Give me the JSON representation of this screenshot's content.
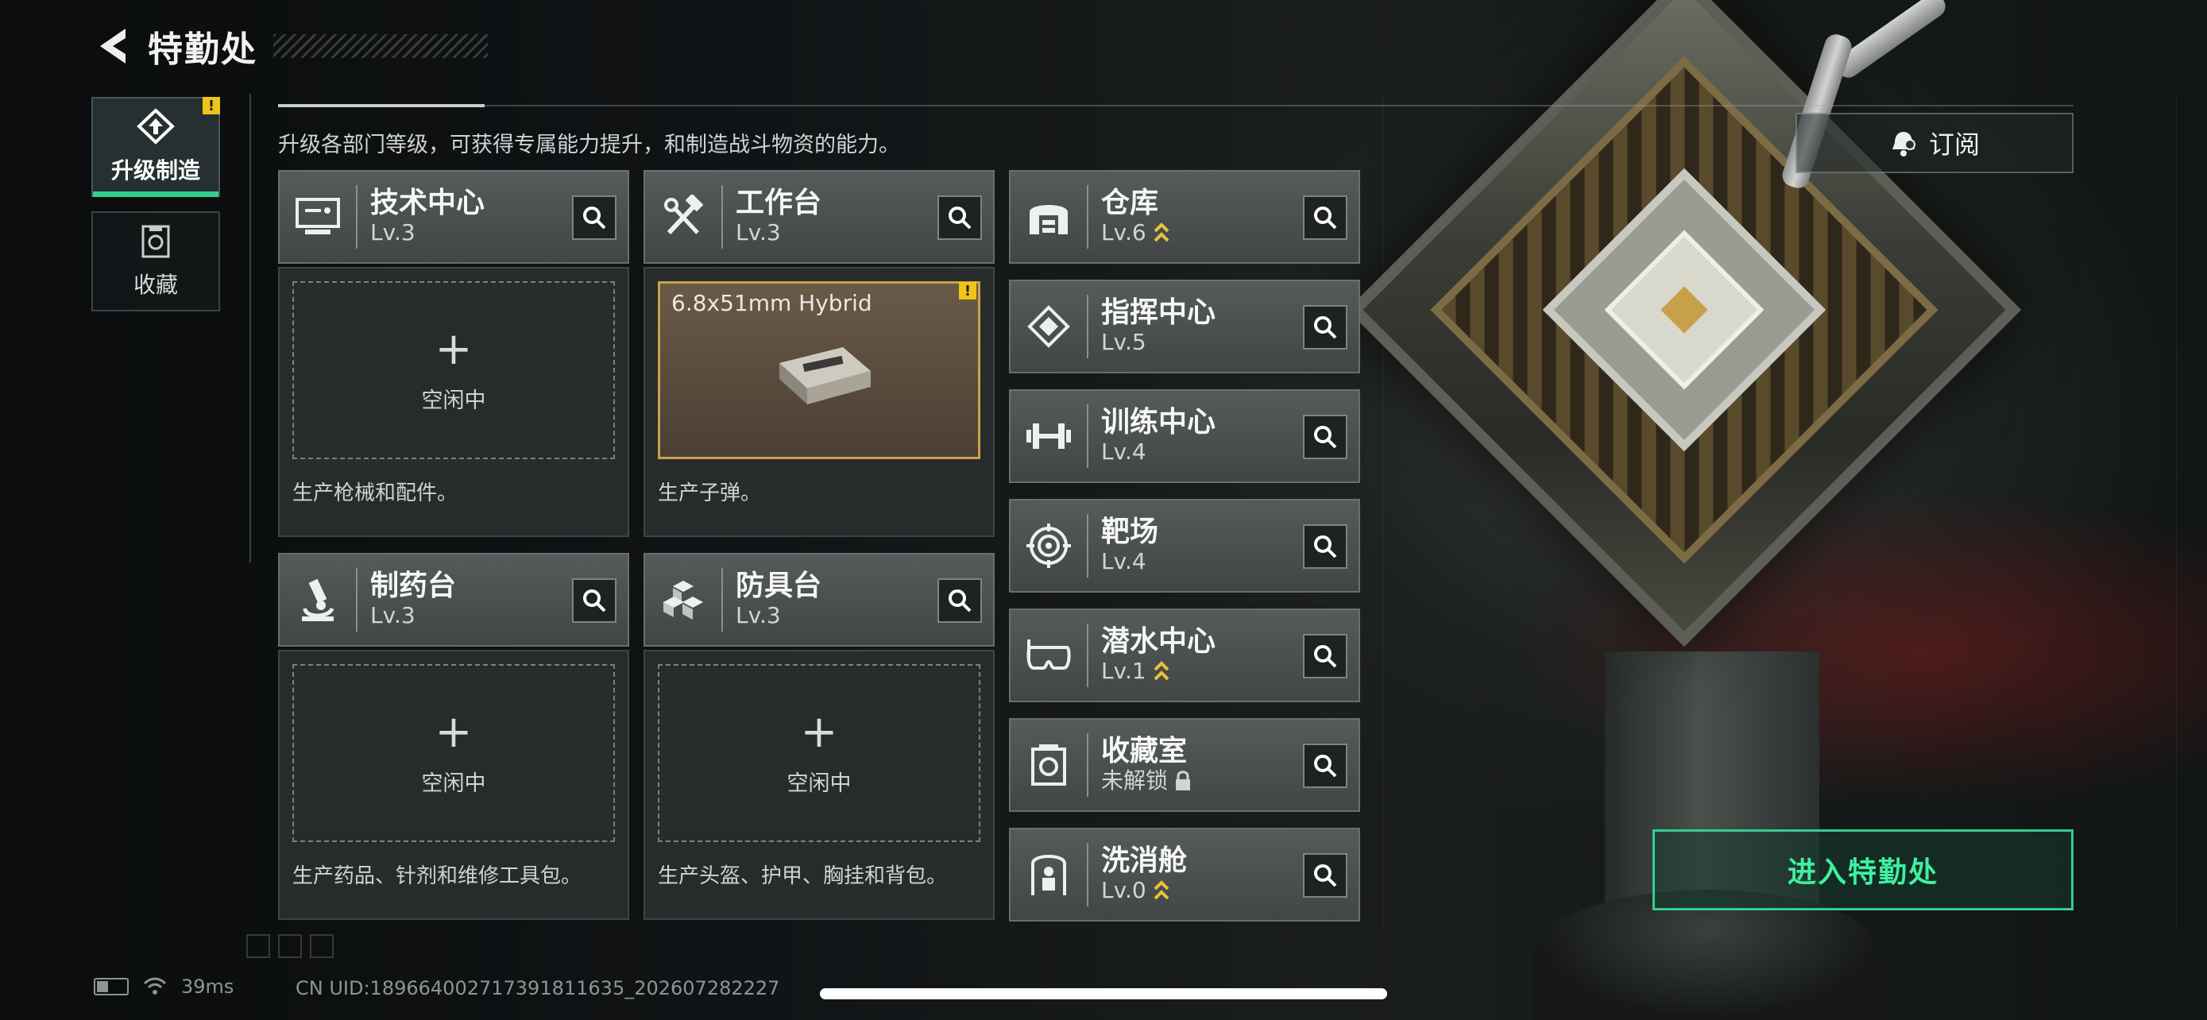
{
  "header": {
    "title": "特勤处",
    "back_icon": "back-arrow-icon"
  },
  "side_tabs": [
    {
      "label": "升级制造",
      "icon": "upgrade-build-icon",
      "active": true,
      "warn": "!"
    },
    {
      "label": "收藏",
      "icon": "collection-icon",
      "active": false
    }
  ],
  "description": "升级各部门等级，可获得专属能力提升，和制造战斗物资的能力。",
  "subscribe": {
    "label": "订阅",
    "icon": "bell-subscribe-icon"
  },
  "departments_main": [
    {
      "name": "技术中心",
      "level": "Lv.3",
      "icon": "monitor-icon",
      "slot_status": "空闲中",
      "desc": "生产枪械和配件。"
    },
    {
      "name": "工作台",
      "level": "Lv.3",
      "icon": "hammer-wrench-icon",
      "producing": "6.8x51mm Hybrid",
      "warn": "!",
      "desc": "生产子弹。"
    },
    {
      "name": "制药台",
      "level": "Lv.3",
      "icon": "microscope-icon",
      "slot_status": "空闲中",
      "desc": "生产药品、针剂和维修工具包。"
    },
    {
      "name": "防具台",
      "level": "Lv.3",
      "icon": "cubes-icon",
      "slot_status": "空闲中",
      "desc": "生产头盔、护甲、胸挂和背包。"
    }
  ],
  "departments_side": [
    {
      "name": "仓库",
      "level": "Lv.6",
      "icon": "warehouse-icon",
      "upgradable": true
    },
    {
      "name": "指挥中心",
      "level": "Lv.5",
      "icon": "chip-icon",
      "upgradable": false
    },
    {
      "name": "训练中心",
      "level": "Lv.4",
      "icon": "dumbbell-icon",
      "upgradable": false
    },
    {
      "name": "靶场",
      "level": "Lv.4",
      "icon": "target-icon",
      "upgradable": false
    },
    {
      "name": "潜水中心",
      "level": "Lv.1",
      "icon": "diving-mask-icon",
      "upgradable": true
    },
    {
      "name": "收藏室",
      "level": "未解锁",
      "icon": "vault-icon",
      "upgradable": false,
      "locked": true
    },
    {
      "name": "洗消舱",
      "level": "Lv.0",
      "icon": "decon-icon",
      "upgradable": true
    }
  ],
  "enter_button": "进入特勤处",
  "status_bar": {
    "ping": "39ms",
    "uid": "CN UID:18966400271739181163​5_202607282227"
  },
  "colors": {
    "accent": "#2fd08c",
    "warn": "#f0c419",
    "upgrade": "#e8c23c"
  }
}
